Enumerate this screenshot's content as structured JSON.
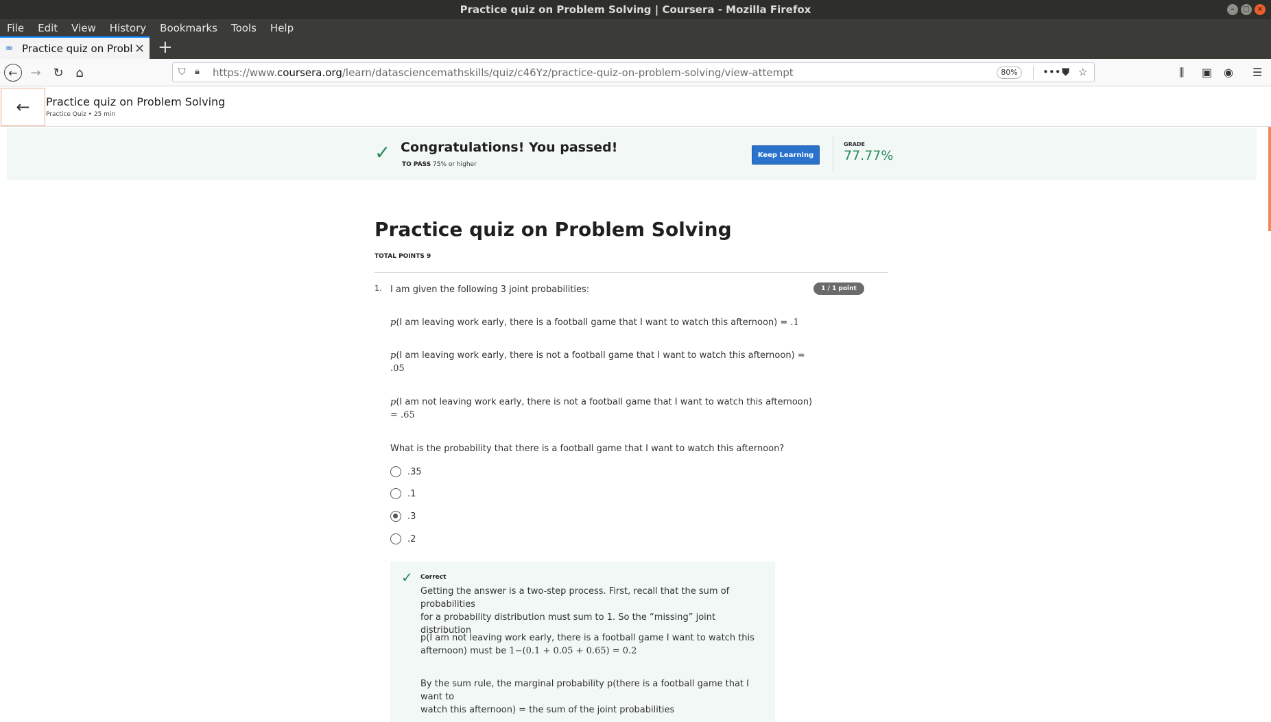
{
  "window": {
    "title": "Practice quiz on Problem Solving | Coursera - Mozilla Firefox"
  },
  "menu": [
    "File",
    "Edit",
    "View",
    "History",
    "Bookmarks",
    "Tools",
    "Help"
  ],
  "tab": {
    "title": "Practice quiz on Problem Solving",
    "favicon": "∞"
  },
  "url": {
    "prefix": "https://www.",
    "domain": "coursera.org",
    "path": "/learn/datasciencemathskills/quiz/c46Yz/practice-quiz-on-problem-solving/view-attempt",
    "zoom": "80%"
  },
  "header": {
    "title": "Practice quiz on Problem Solving",
    "subtitle": "Practice Quiz • 25 min"
  },
  "banner": {
    "congrats": "Congratulations! You passed!",
    "to_pass_label": "TO PASS",
    "to_pass_value": "75% or higher",
    "keep_learning": "Keep Learning",
    "grade_label": "GRADE",
    "grade_value": "77.77%"
  },
  "quiz": {
    "heading": "Practice quiz on Problem Solving",
    "total_points": "TOTAL POINTS 9",
    "question": {
      "number": "1.",
      "badge": "1 / 1 point",
      "intro": "I am given the following 3 joint probabilities:",
      "p_symbol": "p",
      "line1": "(I am leaving work early, there is a football game that I want to watch this afternoon) = ",
      "line1_val": ".1",
      "line2a": "(I am leaving work early, there is not a football game that I want to watch this afternoon) =",
      "line2_val": ".05",
      "line3a": "(I am not leaving work early, there is not a football game that I want to watch this afternoon)",
      "line3_eq": "= ",
      "line3_val": ".65",
      "prompt": "What is the probability that there is a football game that I want to watch this afternoon?",
      "options": [
        {
          "label": ".35",
          "selected": false
        },
        {
          "label": ".1",
          "selected": false
        },
        {
          "label": ".3",
          "selected": true
        },
        {
          "label": ".2",
          "selected": false
        }
      ]
    },
    "feedback": {
      "status": "Correct",
      "para1_l1": "Getting the answer is a two-step process. First, recall that the sum of probabilities",
      "para1_l2": "for a probability distribution must sum to 1. So the “missing” joint distribution",
      "para2_l1": "p(I am not leaving work early, there is a football game I want to watch this",
      "para2_l2": "afternoon) must be ",
      "para2_math": "1−(0.1 + 0.05 + 0.65) = 0.2",
      "para3_l1": "By the sum rule, the marginal probability p(there is a football game that I want to",
      "para3_l2": "watch this afternoon) = the sum of the joint probabilities"
    }
  }
}
